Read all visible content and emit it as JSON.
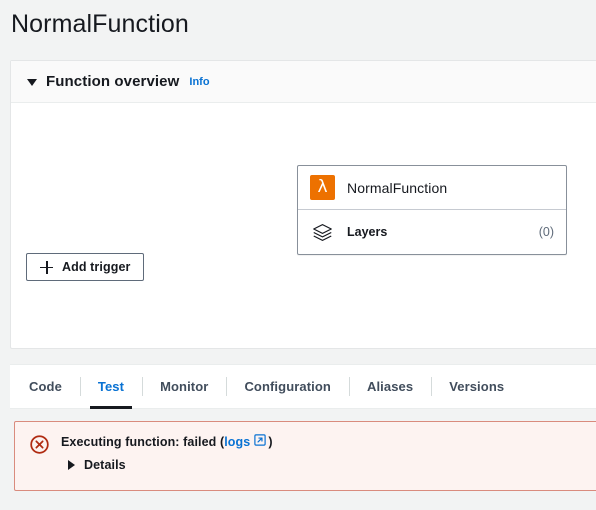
{
  "page": {
    "title": "NormalFunction"
  },
  "overview": {
    "header_label": "Function overview",
    "info_label": "Info",
    "caret_icon": "caret-down-icon",
    "function_card": {
      "lambda_icon": "lambda-icon",
      "function_name": "NormalFunction",
      "layers_icon": "layers-icon",
      "layers_label": "Layers",
      "layers_count": "(0)"
    },
    "add_trigger": {
      "label": "Add trigger",
      "icon": "plus-icon"
    }
  },
  "tabs": [
    {
      "label": "Code",
      "active": false
    },
    {
      "label": "Test",
      "active": true
    },
    {
      "label": "Monitor",
      "active": false
    },
    {
      "label": "Configuration",
      "active": false
    },
    {
      "label": "Aliases",
      "active": false
    },
    {
      "label": "Versions",
      "active": false
    }
  ],
  "alert": {
    "status_icon": "error-circle-x-icon",
    "text_before": "Executing function: failed (",
    "link_label": "logs",
    "external_icon": "external-link-icon",
    "text_after": ")",
    "details_label": "Details",
    "details_caret_icon": "caret-right-icon"
  },
  "colors": {
    "accent_link": "#0972d3",
    "lambda_orange": "#ed7100",
    "error_red": "#b02b12",
    "alert_background": "#fdf3f1",
    "alert_border": "#d98b7d",
    "page_background": "#f2f3f3",
    "active_tab_underline": "#16191f"
  }
}
